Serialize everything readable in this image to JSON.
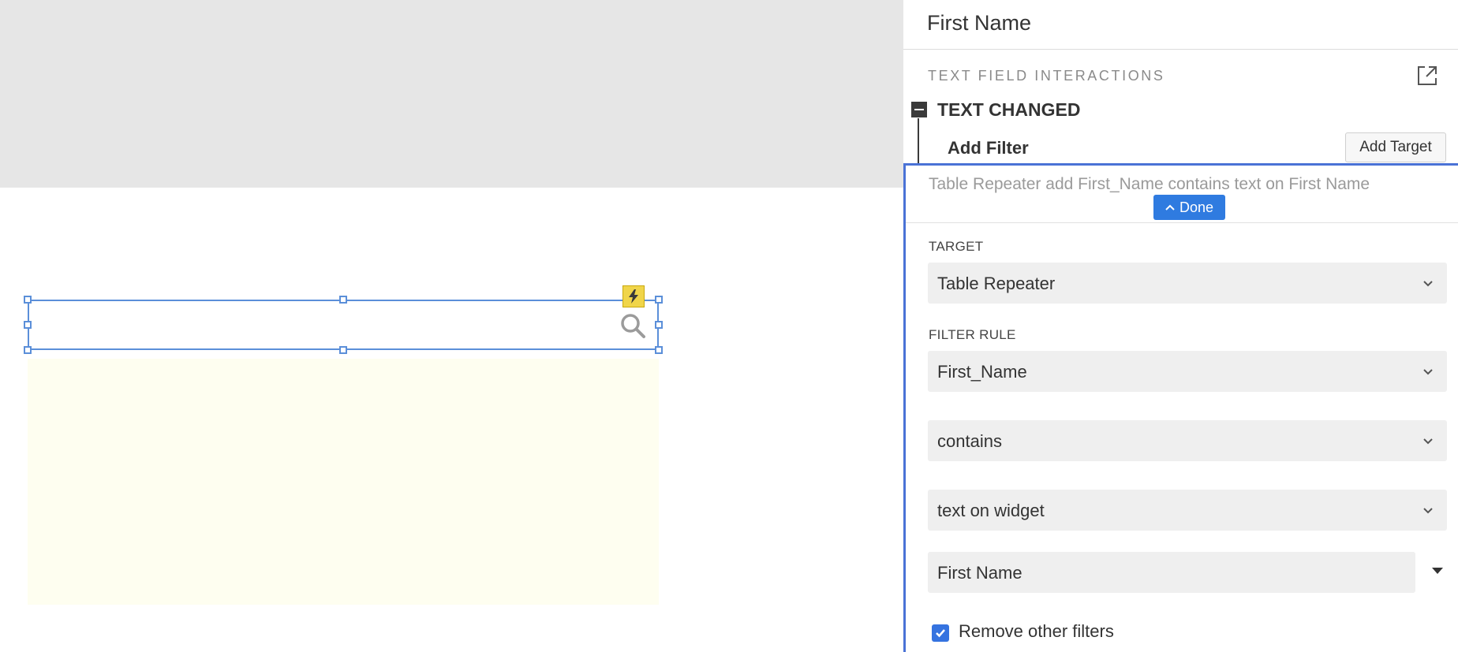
{
  "panel": {
    "title": "First Name",
    "section_title": "TEXT FIELD INTERACTIONS",
    "event": "TEXT CHANGED",
    "action": "Add Filter",
    "add_target_label": "Add Target",
    "summary": "Table Repeater add First_Name contains text on First Name",
    "done_label": "Done",
    "target_label": "TARGET",
    "target_value": "Table Repeater",
    "filter_rule_label": "FILTER RULE",
    "filter_column": "First_Name",
    "filter_operator": "contains",
    "filter_source": "text on widget",
    "filter_widget": "First Name",
    "remove_filters_label": "Remove other filters",
    "remove_filters_checked": true
  },
  "icons": {
    "popout": "external-link-icon",
    "search": "search-icon",
    "lightning": "lightning-icon",
    "collapse": "minus-square-icon",
    "chevron": "chevron-down-icon"
  },
  "colors": {
    "selection": "#5b8fd9",
    "editor_border": "#4a72d6",
    "done_button": "#2f7be0",
    "interaction_badge": "#f0d54a",
    "repeater_bg": "#fefef0"
  }
}
